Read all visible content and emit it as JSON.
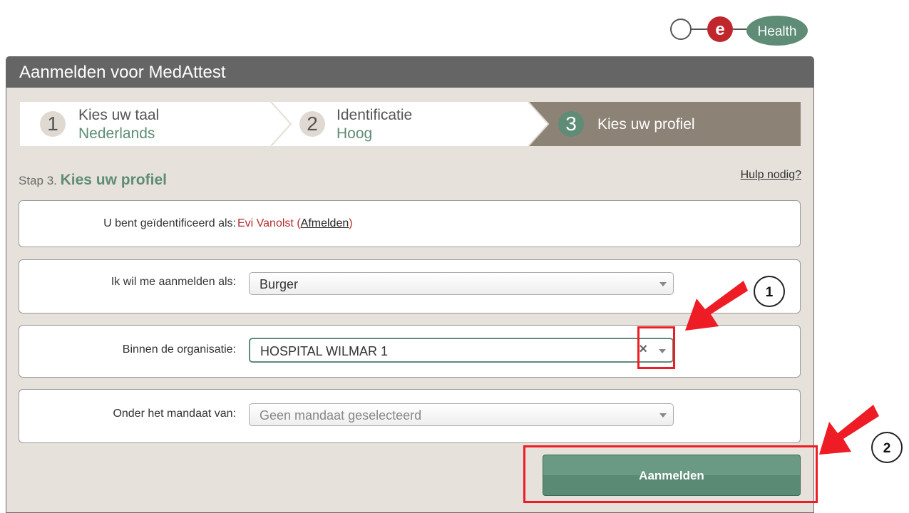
{
  "logo": {
    "letter": "e",
    "word": "Health"
  },
  "panel": {
    "title": "Aanmelden voor MedAttest"
  },
  "steps": [
    {
      "number": "1",
      "title": "Kies uw taal",
      "value": "Nederlands"
    },
    {
      "number": "2",
      "title": "Identificatie",
      "value": "Hoog"
    },
    {
      "number": "3",
      "title": "Kies uw profiel"
    }
  ],
  "heading": {
    "prefix": "Stap 3.",
    "title": "Kies uw profiel",
    "help": "Hulp nodig?"
  },
  "identity": {
    "label": "U bent geïdentificeerd als:",
    "name": "Evi Vanolst",
    "open_paren": "(",
    "logout": "Afmelden",
    "close_paren": ")"
  },
  "role": {
    "label": "Ik wil me aanmelden als:",
    "value": "Burger"
  },
  "organisation": {
    "label": "Binnen de organisatie:",
    "value": "HOSPITAL WILMAR 1",
    "clear": "×"
  },
  "mandate": {
    "label": "Onder het mandaat van:",
    "placeholder": "Geen mandaat geselecteerd"
  },
  "submit": {
    "label": "Aanmelden"
  },
  "annotations": {
    "marker1": "1",
    "marker2": "2"
  },
  "colors": {
    "header": "#656565",
    "accent": "#5e8c76",
    "annotation": "#ee1c24",
    "name": "#b22f2f"
  }
}
